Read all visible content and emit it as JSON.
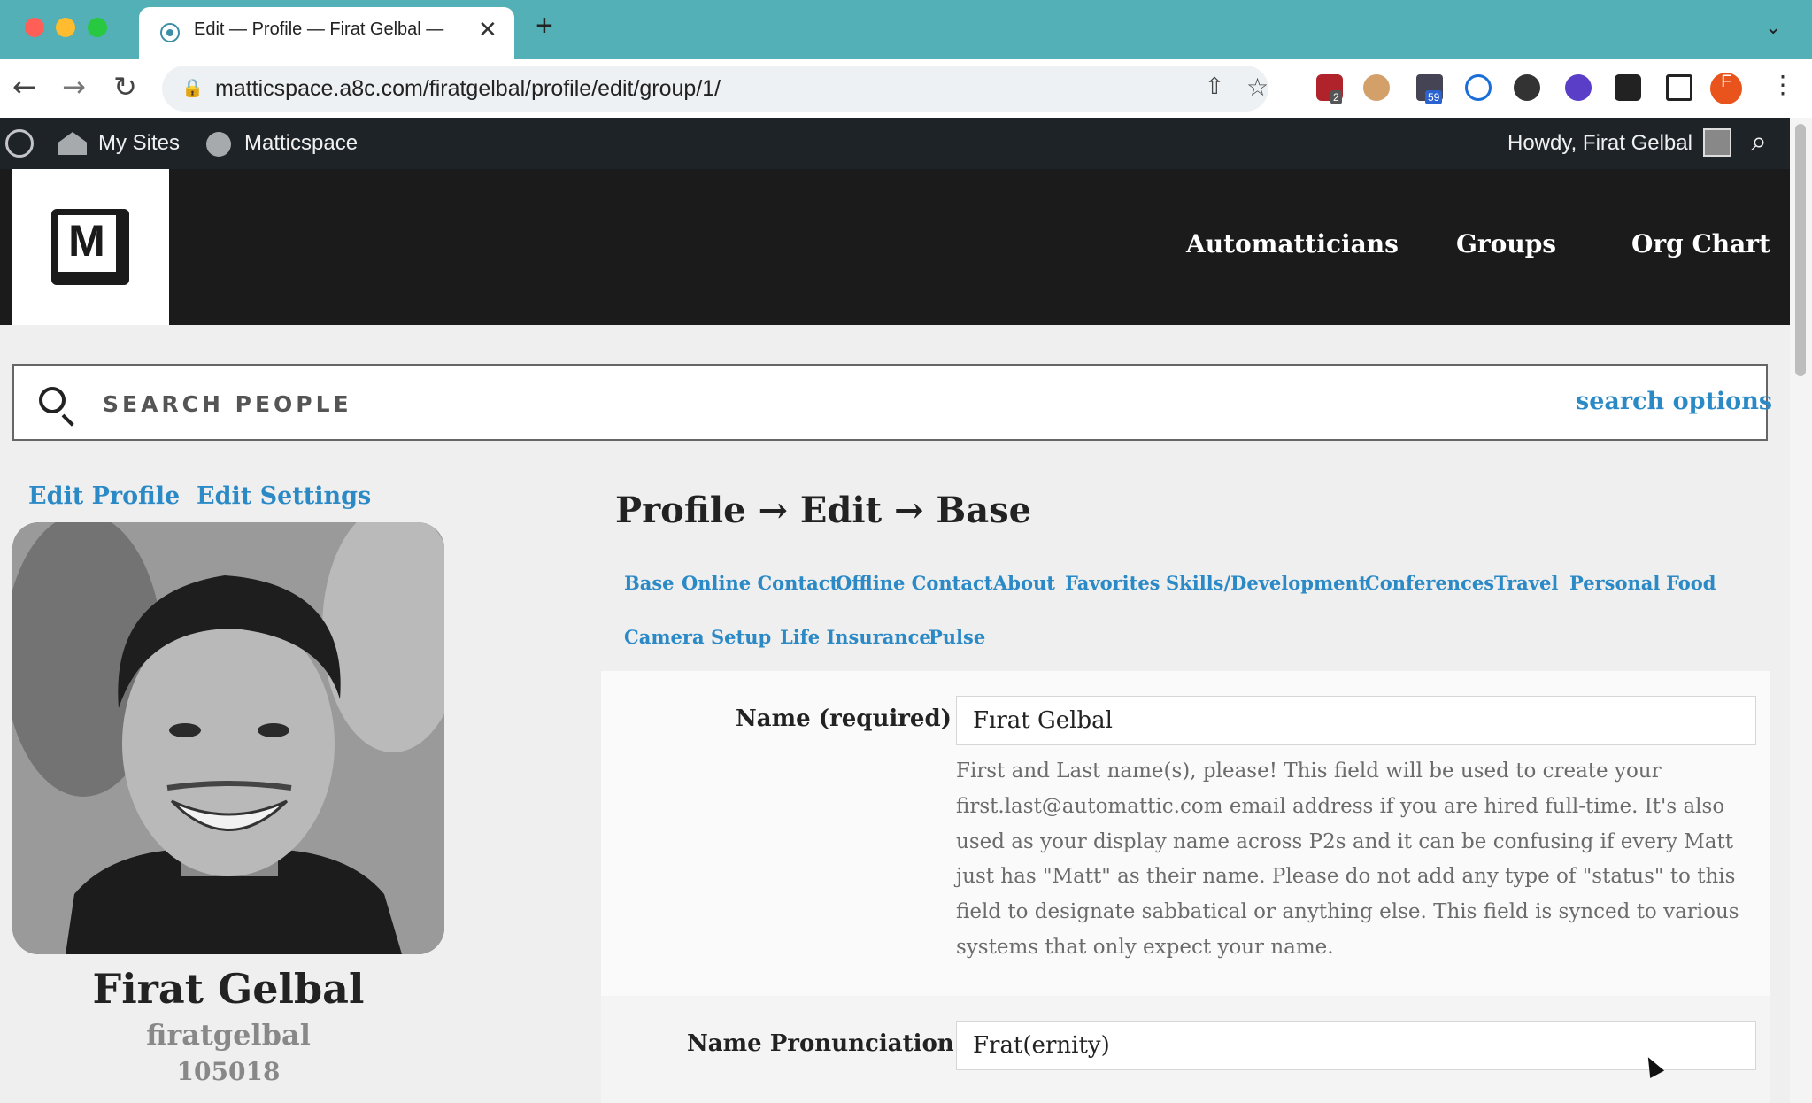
{
  "browser": {
    "tab_title": "Edit — Profile — Firat Gelbal —",
    "tab_close": "✕",
    "new_tab": "+",
    "tab_menu": "⌄",
    "url": "matticspace.a8c.com/firatgelbal/profile/edit/group/1/",
    "back_icon": "←",
    "forward_icon": "→",
    "reload_icon": "↻",
    "lock_icon": "🔒",
    "share_icon": "⇧",
    "star_icon": "☆",
    "ext_badge_1": "2",
    "ext_badge_2": "59",
    "profile_initial": "F",
    "menu_icon": "⋮",
    "traffic_light_colors": [
      "#ff5f57",
      "#febc2e",
      "#28c840"
    ]
  },
  "adminbar": {
    "my_sites": "My Sites",
    "site_name": "Matticspace",
    "howdy": "Howdy, Firat Gelbal",
    "search_icon": "⌕"
  },
  "header": {
    "logo_letter": "M",
    "nav": [
      "Automatticians",
      "Groups",
      "Org Chart"
    ]
  },
  "search": {
    "placeholder": "SEARCH PEOPLE",
    "options_link": "search options"
  },
  "sidebar": {
    "edit_profile": "Edit Profile",
    "edit_settings": "Edit Settings",
    "full_name": "Firat Gelbal",
    "username": "firatgelbal",
    "user_id": "105018"
  },
  "main": {
    "heading": "Profile → Edit → Base",
    "tabs_row1": [
      "Base",
      "Online Contact",
      "Offline Contact",
      "About",
      "Favorites",
      "Skills/Development",
      "Conferences",
      "Travel",
      "Personal",
      "Food"
    ],
    "tabs_row2": [
      "Camera",
      "Setup",
      "Life Insurance",
      "Pulse"
    ],
    "fields": {
      "name_label": "Name (required)",
      "name_value": "Fırat Gelbal",
      "name_help": "First and Last name(s), please! This field will be used to create your first.last@automattic.com email address if you are hired full-time. It's also used as your display name across P2s and it can be confusing if every Matt just has \"Matt\" as their name. Please do not add any type of \"status\" to this field to designate sabbatical or anything else. This field is synced to various systems that only expect your name.",
      "pronunciation_label": "Name Pronunciation",
      "pronunciation_value": "Frat(ernity)"
    }
  },
  "colors": {
    "link": "#2b8ac6",
    "tabbar": "#52b0b6",
    "adminbar": "#1d2327",
    "header": "#1b1b1b"
  }
}
